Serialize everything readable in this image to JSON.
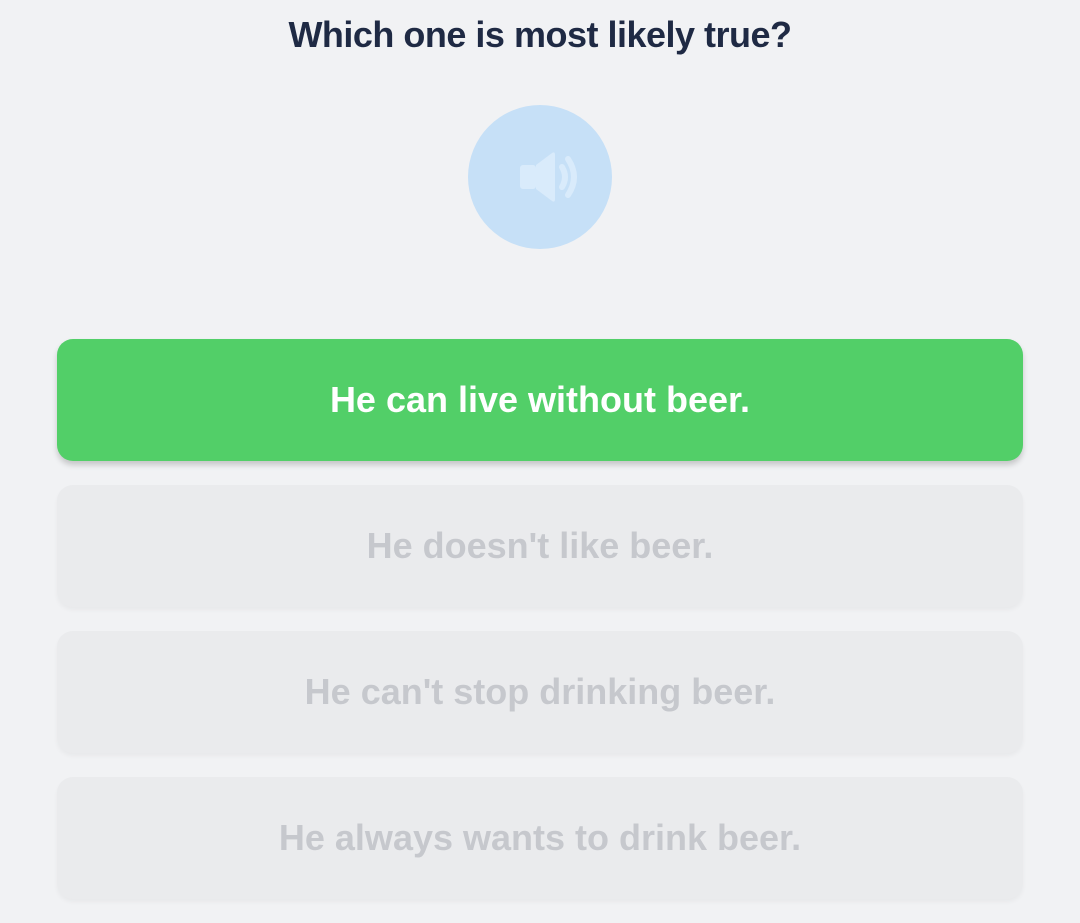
{
  "question": {
    "text": "Which one is most likely true?"
  },
  "audio": {
    "icon": "speaker-icon",
    "color": "#c6e0f7"
  },
  "answers": [
    {
      "label": "He can live without beer.",
      "state": "selected"
    },
    {
      "label": "He doesn't like beer.",
      "state": "disabled"
    },
    {
      "label": "He can't stop drinking beer.",
      "state": "disabled"
    },
    {
      "label": "He always wants to drink beer.",
      "state": "disabled"
    }
  ],
  "colors": {
    "selected": "#52cf68",
    "disabled_bg": "#eaebed",
    "disabled_text": "#c6c8cd",
    "title": "#1f2a44",
    "background": "#f1f2f4"
  }
}
